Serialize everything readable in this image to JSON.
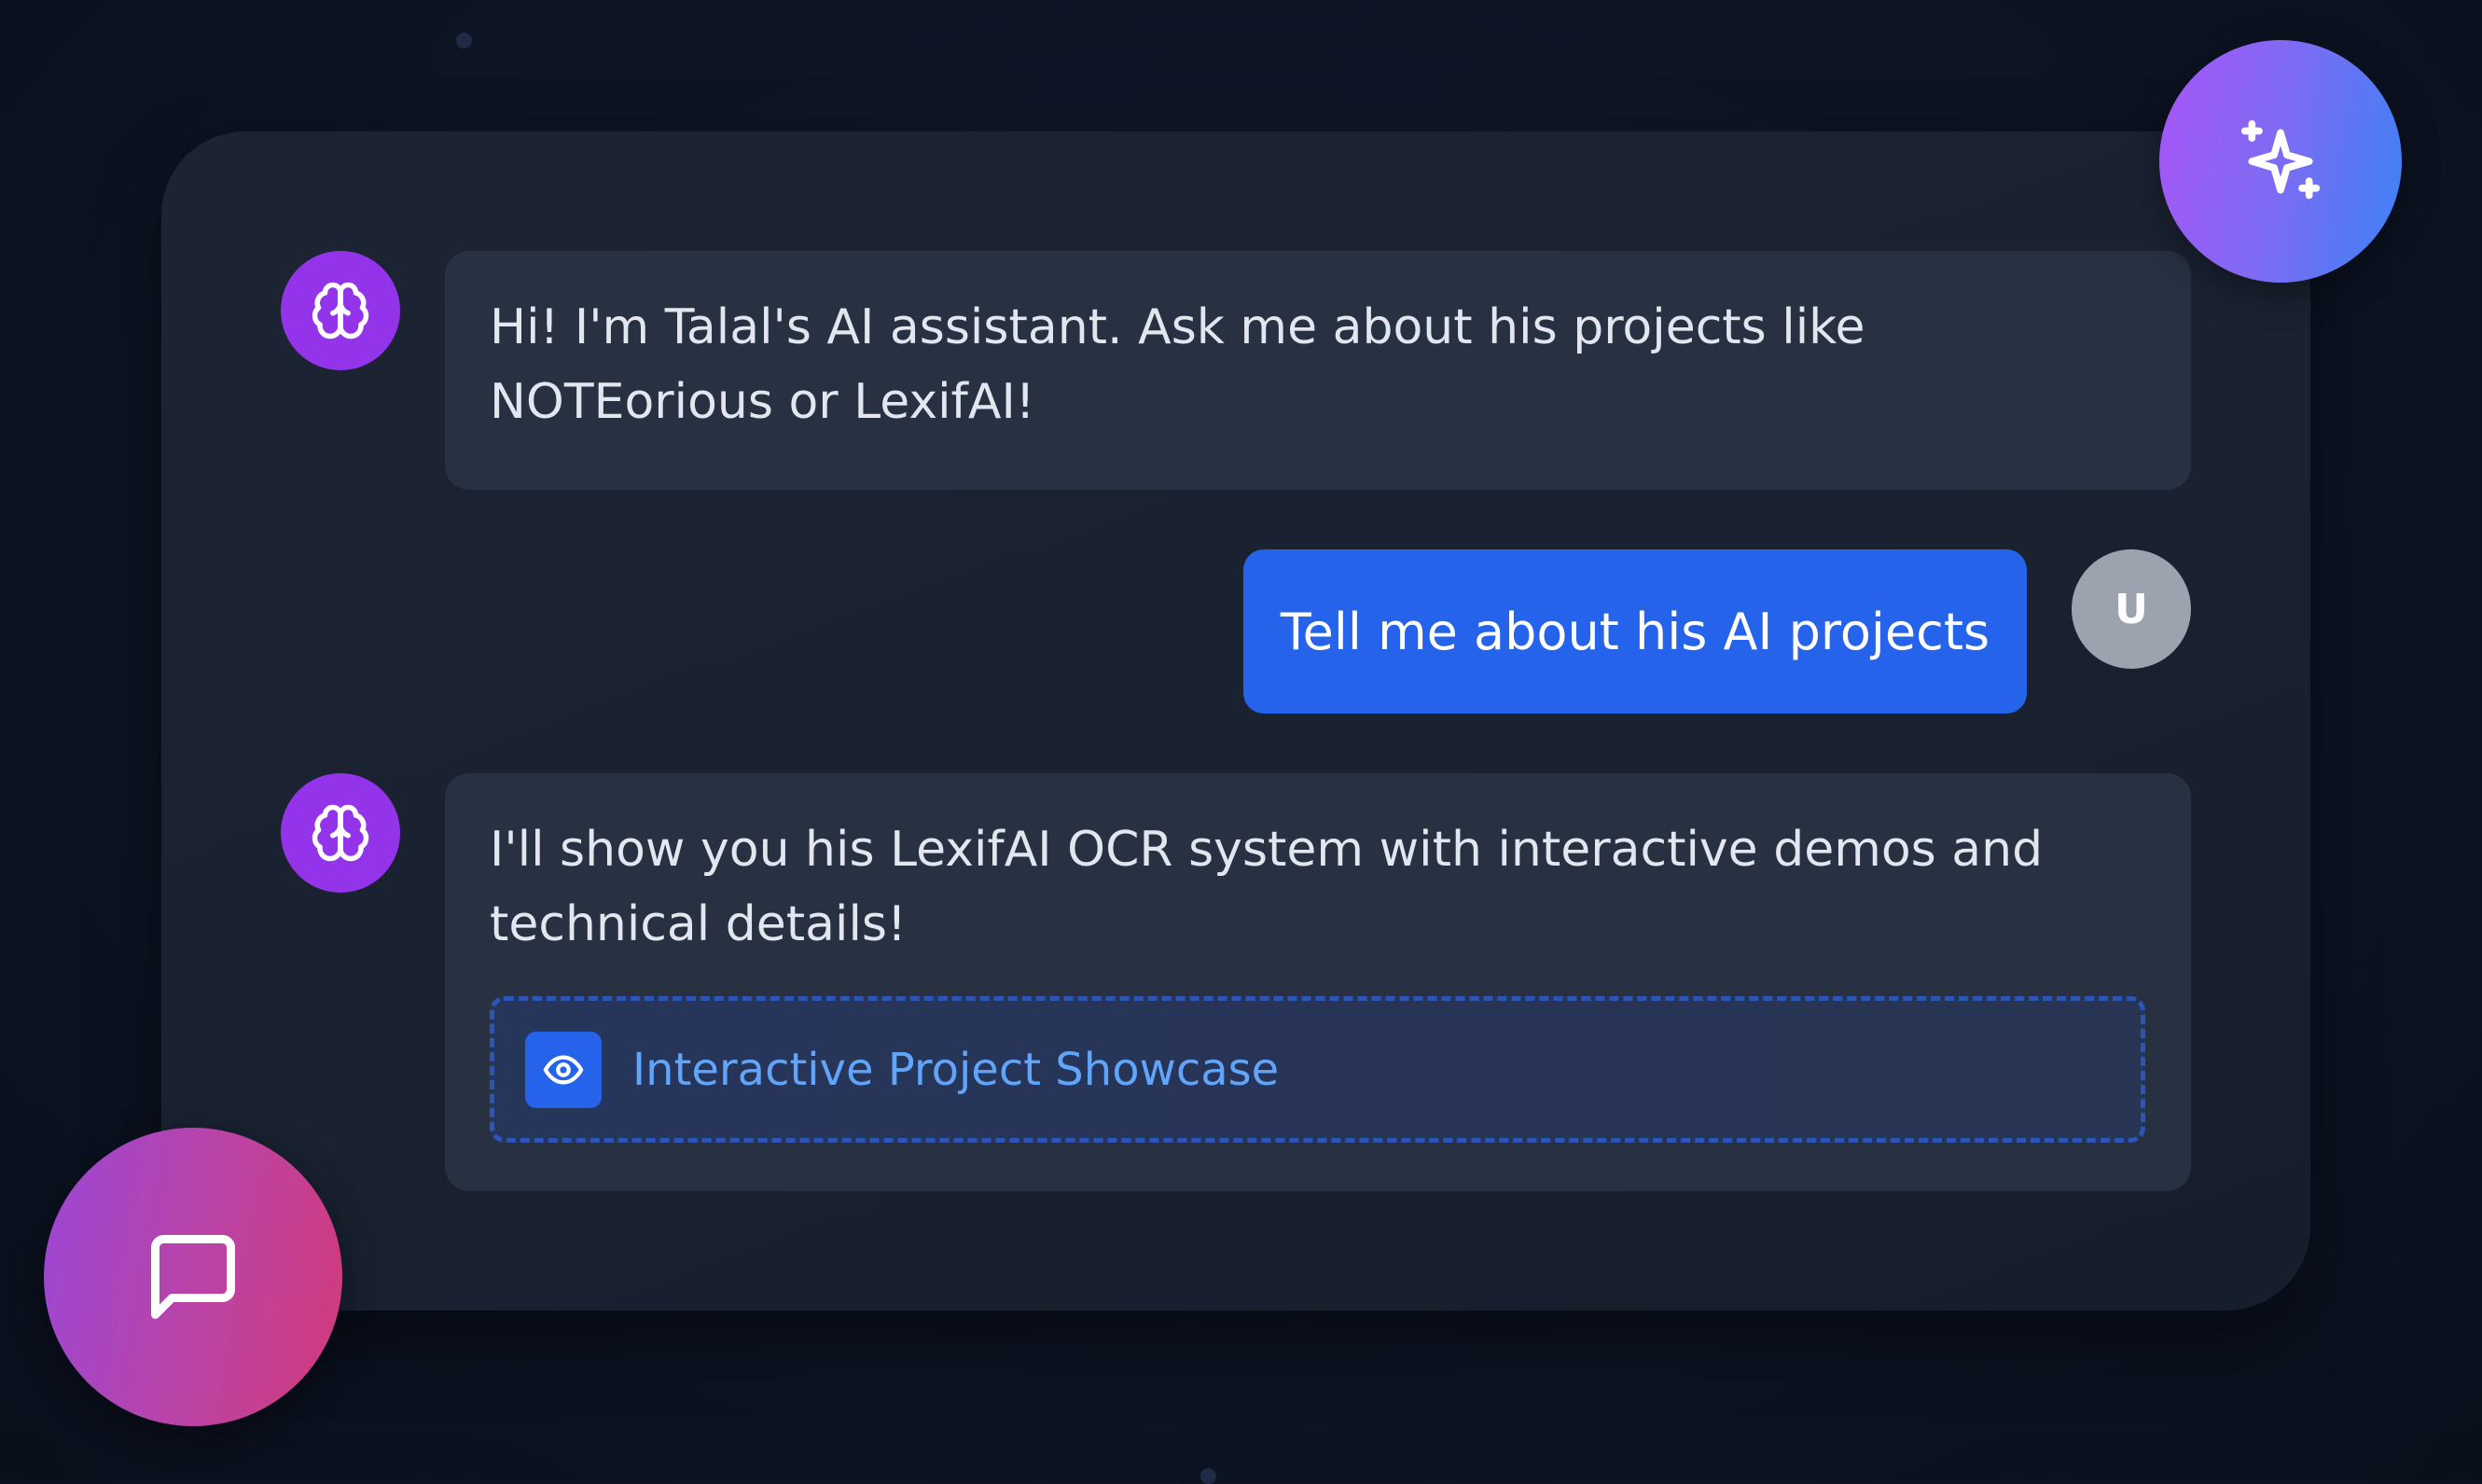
{
  "messages": [
    {
      "role": "assistant",
      "avatar_icon": "brain-icon",
      "text": "Hi! I'm Talal's AI assistant. Ask me about his projects like NOTEorious or LexifAI!"
    },
    {
      "role": "user",
      "avatar_label": "U",
      "text": "Tell me about his AI projects"
    },
    {
      "role": "assistant",
      "avatar_icon": "brain-icon",
      "text": "I'll show you his LexifAI OCR system with interactive demos and technical details!",
      "attachment": {
        "icon": "eye-icon",
        "label": "Interactive Project Showcase"
      }
    }
  ],
  "floating_buttons": {
    "top_right_icon": "sparkles-icon",
    "bottom_left_icon": "chat-bubble-icon"
  },
  "colors": {
    "assistant_avatar": "#9333ea",
    "user_avatar": "#9ca3af",
    "user_bubble": "#2563eb",
    "assistant_bubble": "#283142",
    "showcase_text": "#60a5fa",
    "showcase_border": "#2b56b8"
  }
}
